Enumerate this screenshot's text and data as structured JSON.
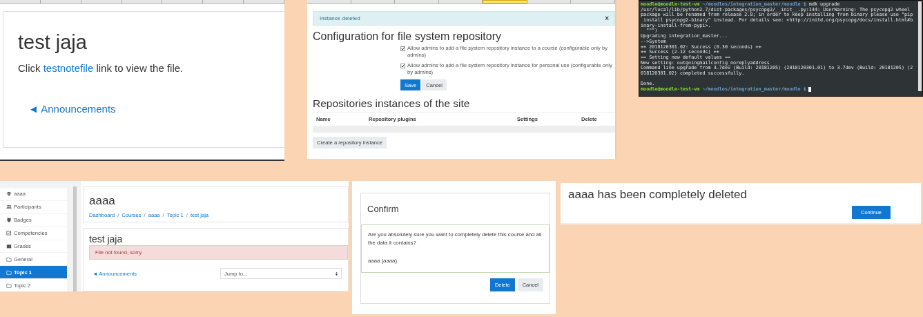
{
  "file_page": {
    "title": "test jaja",
    "message_start": "Click",
    "file_link": "testnotefile",
    "message_end": "link to view the file.",
    "link": "Announcements",
    "link_arrow": "◄"
  },
  "repository_config": {
    "tab_cells": [
      {
        "selected": false
      },
      {
        "selected": false
      },
      {
        "selected": false
      },
      {
        "selected": false
      },
      {
        "selected": true
      },
      {
        "selected": false
      },
      {
        "selected": false
      }
    ],
    "alert": "Instance deleted",
    "alert_close": "×",
    "heading": "Configuration for file system repository",
    "options": [
      {
        "label": "Allow admins to add a file system repository instance to a course (configurable only by admins)",
        "checked": true
      },
      {
        "label": "Allow admins to add a file system repository instance for personal use (configurable only by admins)",
        "checked": true
      }
    ],
    "buttons": [
      {
        "label": "Save",
        "kind": "primary"
      },
      {
        "label": "Cancel",
        "kind": "secondary"
      }
    ],
    "table_heading": "Repositories instances of the site",
    "table": {
      "columns": [
        "Name",
        "Repository plugins",
        "Settings",
        "Delete"
      ]
    },
    "create_button": "Create a repository instance"
  },
  "terminal": {
    "lines": [
      {
        "kind": "prompt",
        "user": "moodle@moodle-test-vm",
        "path": "~/moodles/integration_master/moodle $",
        "command": "mdk upgrade",
        "cursor": false
      },
      {
        "kind": "output",
        "text": "/usr/local/lib/python2.7/dist-packages/psycopg2/__init__.py:144: UserWarning: The psycopg2 wheel"
      },
      {
        "kind": "output",
        "text": "package will be renamed from release 2.8; in order to keep installing from binary please use \"pip"
      },
      {
        "kind": "output",
        "text": " install psycopg2-binary\" instead. For details see: <http://initd.org/psycopg/docs/install.html#b"
      },
      {
        "kind": "output",
        "text": "inary-install-from-pypi>."
      },
      {
        "kind": "output",
        "text": "  \"\"\")"
      },
      {
        "kind": "output",
        "text": "Upgrading integration_master..."
      },
      {
        "kind": "output",
        "text": "-->System"
      },
      {
        "kind": "output",
        "text": "++ 2018120301.02: Success (0.30 seconds) ++"
      },
      {
        "kind": "output",
        "text": "++ Success (2.12 seconds) ++"
      },
      {
        "kind": "output",
        "text": "== Setting new default values =="
      },
      {
        "kind": "output",
        "text": "New setting: outgoingmailconfig_noreplyaddress"
      },
      {
        "kind": "output",
        "text": "Command line upgrade from 3.7dev (Build: 20181205) (2018120301.01) to 3.7dev (Build: 20181205) (2"
      },
      {
        "kind": "output",
        "text": "018120301.02) completed successfully."
      },
      {
        "kind": "blank"
      },
      {
        "kind": "output",
        "text": "Done."
      },
      {
        "kind": "prompt",
        "user": "moodle@moodle-test-vm",
        "path": "~/moodles/integration_master/moodle $",
        "cursor": true
      }
    ]
  },
  "course_page": {
    "sidebar": {
      "items": [
        {
          "kind": "course",
          "label": "aaaa",
          "selected": false
        },
        {
          "kind": "participants",
          "label": "Participants",
          "selected": false
        },
        {
          "kind": "badges",
          "label": "Badges",
          "selected": false
        },
        {
          "kind": "competencies",
          "label": "Competencies",
          "selected": false
        },
        {
          "kind": "grades",
          "label": "Grades",
          "selected": false
        },
        {
          "kind": "section",
          "label": "General",
          "selected": false
        },
        {
          "kind": "section",
          "label": "Topic 1",
          "selected": true
        },
        {
          "kind": "section",
          "label": "Topic 2",
          "selected": false
        }
      ]
    },
    "course_title": "aaaa",
    "breadcrumb": [
      "Dashboard",
      "Courses",
      "aaaa",
      "Topic 1",
      "test jaja"
    ],
    "breadcrumb_separator": "/",
    "activity_title": "test jaja",
    "error": "File not found, sorry.",
    "prev_link": "Announcements",
    "prev_arrow": "◄",
    "jump_select": {
      "value": "Jump to..."
    }
  },
  "confirm_dialog": {
    "title": "Confirm",
    "message": "Are you absolutely sure you want to completely delete this course and all the data it contains?",
    "detail": "aaaa (aaaa)",
    "buttons": [
      {
        "label": "Delete",
        "kind": "primary"
      },
      {
        "label": "Cancel",
        "kind": "secondary"
      }
    ]
  },
  "deleted_notice": {
    "message": "aaaa has been completely deleted",
    "button": "Continue"
  }
}
